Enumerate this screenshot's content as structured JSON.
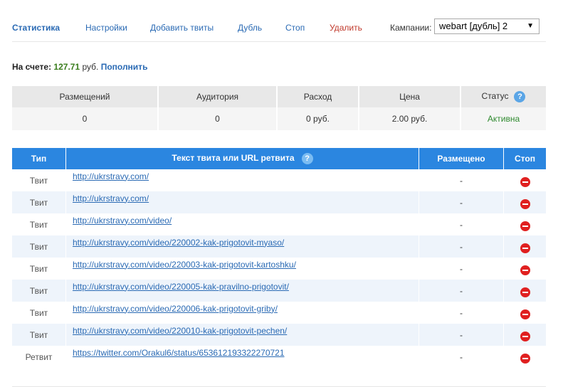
{
  "nav": {
    "items": [
      {
        "label": "Статистика",
        "active": true
      },
      {
        "label": "Настройки"
      },
      {
        "label": "Добавить твиты"
      },
      {
        "label": "Дубль"
      },
      {
        "label": "Стоп"
      },
      {
        "label": "Удалить",
        "danger": true
      }
    ],
    "campaign_label": "Кампании:",
    "campaign_value": "webart [дубль] 2"
  },
  "balance": {
    "label": "На счете:",
    "amount": "127.71",
    "currency": "руб.",
    "topup": "Пополнить"
  },
  "stats": {
    "headers": [
      "Размещений",
      "Аудитория",
      "Расход",
      "Цена",
      "Статус"
    ],
    "values": [
      "0",
      "0",
      "0 руб.",
      "2.00 руб.",
      "Активна"
    ],
    "help_icon": "?"
  },
  "tweets": {
    "headers": [
      "Тип",
      "Текст твита или URL ретвита",
      "Размещено",
      "Стоп"
    ],
    "help_icon": "?",
    "rows": [
      {
        "type": "Твит",
        "url": "http://ukrstravy.com/",
        "placed": "-"
      },
      {
        "type": "Твит",
        "url": "http://ukrstravy.com/",
        "placed": "-"
      },
      {
        "type": "Твит",
        "url": "http://ukrstravy.com/video/",
        "placed": "-"
      },
      {
        "type": "Твит",
        "url": "http://ukrstravy.com/video/220002-kak-prigotovit-myaso/",
        "placed": "-"
      },
      {
        "type": "Твит",
        "url": "http://ukrstravy.com/video/220003-kak-prigotovit-kartoshku/",
        "placed": "-"
      },
      {
        "type": "Твит",
        "url": "http://ukrstravy.com/video/220005-kak-pravilno-prigotovit/",
        "placed": "-"
      },
      {
        "type": "Твит",
        "url": "http://ukrstravy.com/video/220006-kak-prigotovit-griby/",
        "placed": "-"
      },
      {
        "type": "Твит",
        "url": "http://ukrstravy.com/video/220010-kak-prigotovit-pechen/",
        "placed": "-"
      },
      {
        "type": "Ретвит",
        "url": "https://twitter.com/Orakul6/status/653612193322270721",
        "placed": "-"
      }
    ]
  },
  "colors": {
    "accent": "#2b86e0",
    "link": "#2a6ab4",
    "balance_amount": "#3a7d1d",
    "status_active": "#2f8a2f",
    "stop": "#e02020"
  }
}
